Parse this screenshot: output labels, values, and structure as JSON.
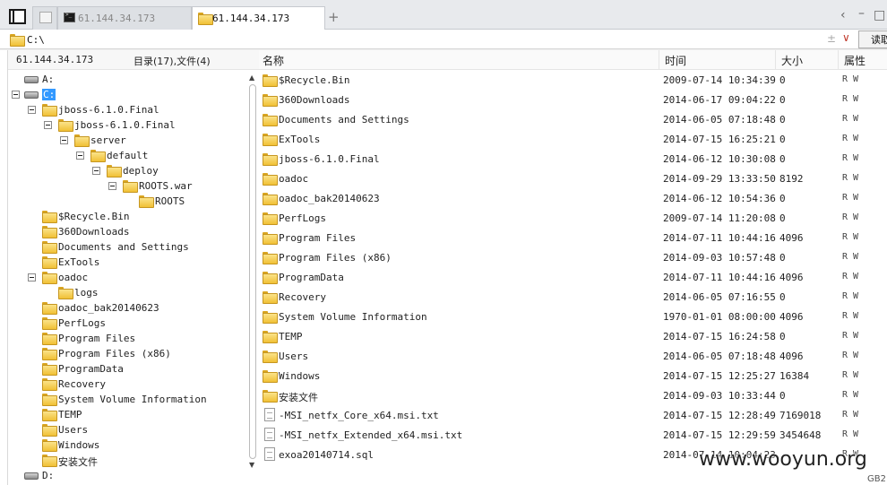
{
  "tabs": [
    {
      "label": "61.144.34.173",
      "active": false
    },
    {
      "label": "61.144.34.173",
      "active": true
    }
  ],
  "address": {
    "value": "C:\\"
  },
  "read_button": "读取",
  "left_header": {
    "ip": "61.144.34.173",
    "counts": "目录(17),文件(4)"
  },
  "columns": {
    "name": "名称",
    "time": "时间",
    "size": "大小",
    "attr": "属性"
  },
  "tree": [
    {
      "label": "A:",
      "level": 0,
      "icon": "drive",
      "toggle": false
    },
    {
      "label": "C:",
      "level": 0,
      "icon": "drive",
      "toggle": true,
      "selected": true
    },
    {
      "label": "jboss-6.1.0.Final",
      "level": 1,
      "icon": "folder",
      "toggle": true
    },
    {
      "label": "jboss-6.1.0.Final",
      "level": 2,
      "icon": "folder",
      "toggle": true
    },
    {
      "label": "server",
      "level": 3,
      "icon": "folder",
      "toggle": true
    },
    {
      "label": "default",
      "level": 4,
      "icon": "folder",
      "toggle": true
    },
    {
      "label": "deploy",
      "level": 5,
      "icon": "folder",
      "toggle": true
    },
    {
      "label": "ROOTS.war",
      "level": 6,
      "icon": "folder",
      "toggle": true
    },
    {
      "label": "ROOTS",
      "level": 7,
      "icon": "folder",
      "toggle": false
    },
    {
      "label": "$Recycle.Bin",
      "level": 1,
      "icon": "folder",
      "toggle": false
    },
    {
      "label": "360Downloads",
      "level": 1,
      "icon": "folder",
      "toggle": false
    },
    {
      "label": "Documents and Settings",
      "level": 1,
      "icon": "folder",
      "toggle": false
    },
    {
      "label": "ExTools",
      "level": 1,
      "icon": "folder",
      "toggle": false
    },
    {
      "label": "oadoc",
      "level": 1,
      "icon": "folder",
      "toggle": true
    },
    {
      "label": "logs",
      "level": 2,
      "icon": "folder",
      "toggle": false
    },
    {
      "label": "oadoc_bak20140623",
      "level": 1,
      "icon": "folder",
      "toggle": false
    },
    {
      "label": "PerfLogs",
      "level": 1,
      "icon": "folder",
      "toggle": false
    },
    {
      "label": "Program Files",
      "level": 1,
      "icon": "folder",
      "toggle": false
    },
    {
      "label": "Program Files (x86)",
      "level": 1,
      "icon": "folder",
      "toggle": false
    },
    {
      "label": "ProgramData",
      "level": 1,
      "icon": "folder",
      "toggle": false
    },
    {
      "label": "Recovery",
      "level": 1,
      "icon": "folder",
      "toggle": false
    },
    {
      "label": "System Volume Information",
      "level": 1,
      "icon": "folder",
      "toggle": false
    },
    {
      "label": "TEMP",
      "level": 1,
      "icon": "folder",
      "toggle": false
    },
    {
      "label": "Users",
      "level": 1,
      "icon": "folder",
      "toggle": false
    },
    {
      "label": "Windows",
      "level": 1,
      "icon": "folder",
      "toggle": false
    },
    {
      "label": "安装文件",
      "level": 1,
      "icon": "folder",
      "toggle": false
    },
    {
      "label": "D:",
      "level": 0,
      "icon": "drive",
      "toggle": false
    }
  ],
  "files": [
    {
      "name": "$Recycle.Bin",
      "time": "2009-07-14 10:34:39",
      "size": "0",
      "attr": "R W",
      "type": "folder"
    },
    {
      "name": "360Downloads",
      "time": "2014-06-17 09:04:22",
      "size": "0",
      "attr": "R W",
      "type": "folder"
    },
    {
      "name": "Documents and Settings",
      "time": "2014-06-05 07:18:48",
      "size": "0",
      "attr": "R W",
      "type": "folder"
    },
    {
      "name": "ExTools",
      "time": "2014-07-15 16:25:21",
      "size": "0",
      "attr": "R W",
      "type": "folder"
    },
    {
      "name": "jboss-6.1.0.Final",
      "time": "2014-06-12 10:30:08",
      "size": "0",
      "attr": "R W",
      "type": "folder"
    },
    {
      "name": "oadoc",
      "time": "2014-09-29 13:33:50",
      "size": "8192",
      "attr": "R W",
      "type": "folder"
    },
    {
      "name": "oadoc_bak20140623",
      "time": "2014-06-12 10:54:36",
      "size": "0",
      "attr": "R W",
      "type": "folder"
    },
    {
      "name": "PerfLogs",
      "time": "2009-07-14 11:20:08",
      "size": "0",
      "attr": "R W",
      "type": "folder"
    },
    {
      "name": "Program Files",
      "time": "2014-07-11 10:44:16",
      "size": "4096",
      "attr": "R W",
      "type": "folder"
    },
    {
      "name": "Program Files (x86)",
      "time": "2014-09-03 10:57:48",
      "size": "0",
      "attr": "R W",
      "type": "folder"
    },
    {
      "name": "ProgramData",
      "time": "2014-07-11 10:44:16",
      "size": "4096",
      "attr": "R W",
      "type": "folder"
    },
    {
      "name": "Recovery",
      "time": "2014-06-05 07:16:55",
      "size": "0",
      "attr": "R W",
      "type": "folder"
    },
    {
      "name": "System Volume Information",
      "time": "1970-01-01 08:00:00",
      "size": "4096",
      "attr": "R W",
      "type": "folder"
    },
    {
      "name": "TEMP",
      "time": "2014-07-15 16:24:58",
      "size": "0",
      "attr": "R W",
      "type": "folder"
    },
    {
      "name": "Users",
      "time": "2014-06-05 07:18:48",
      "size": "4096",
      "attr": "R W",
      "type": "folder"
    },
    {
      "name": "Windows",
      "time": "2014-07-15 12:25:27",
      "size": "16384",
      "attr": "R W",
      "type": "folder"
    },
    {
      "name": "安装文件",
      "time": "2014-09-03 10:33:44",
      "size": "0",
      "attr": "R W",
      "type": "folder"
    },
    {
      "name": "-MSI_netfx_Core_x64.msi.txt",
      "time": "2014-07-15 12:28:49",
      "size": "7169018",
      "attr": "R W",
      "type": "file"
    },
    {
      "name": "-MSI_netfx_Extended_x64.msi.txt",
      "time": "2014-07-15 12:29:59",
      "size": "3454648",
      "attr": "R W",
      "type": "file"
    },
    {
      "name": "exoa20140714.sql",
      "time": "2014-07-14 10:04:23",
      "size": "",
      "attr": "R W",
      "type": "file"
    }
  ],
  "watermark": "www.wooyun.org",
  "status_fragment": "GB2"
}
